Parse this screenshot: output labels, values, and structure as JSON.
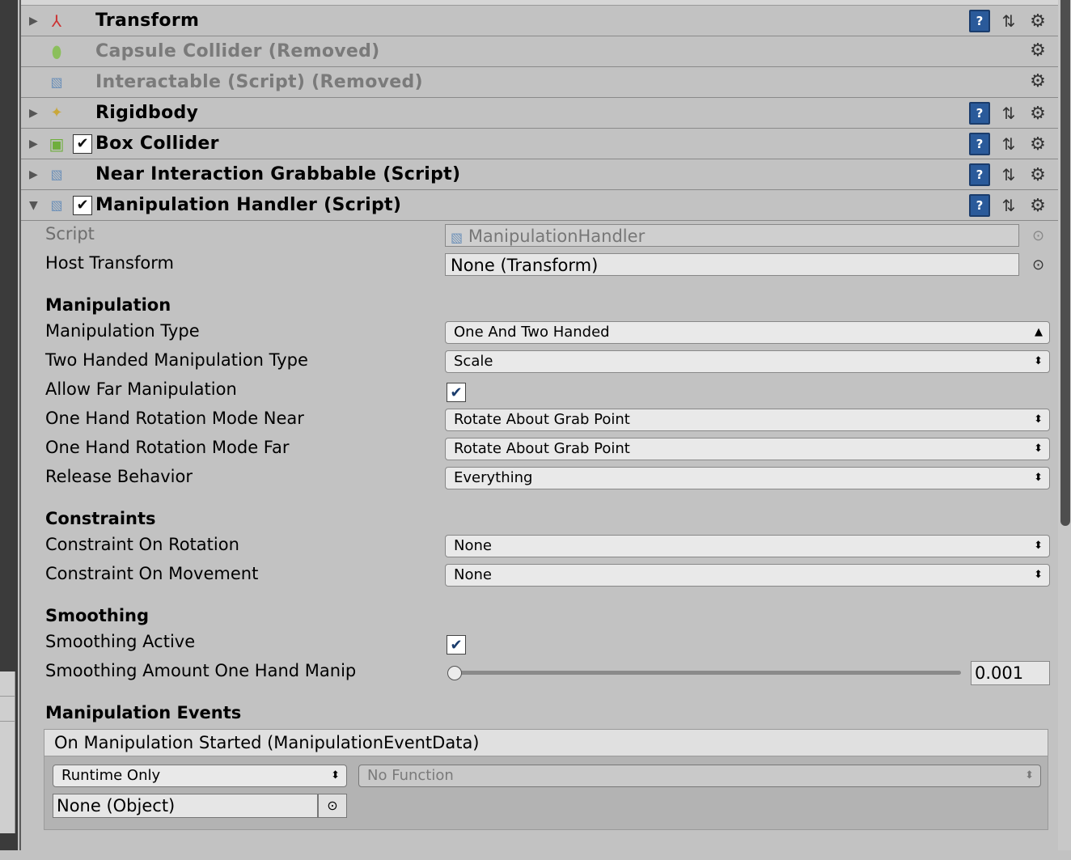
{
  "components": [
    {
      "title": "Transform",
      "removed": false,
      "icon": "transform-icon",
      "has_check": false,
      "foldable": true,
      "icons": [
        "book",
        "sliders",
        "gear"
      ]
    },
    {
      "title": "Capsule Collider (Removed)",
      "removed": true,
      "icon": "capsule-collider-icon",
      "has_check": false,
      "foldable": false,
      "icons": [
        "gear"
      ]
    },
    {
      "title": "Interactable (Script) (Removed)",
      "removed": true,
      "icon": "script-icon",
      "has_check": false,
      "foldable": false,
      "icons": [
        "gear"
      ]
    },
    {
      "title": "Rigidbody",
      "removed": false,
      "icon": "rigidbody-icon",
      "has_check": false,
      "foldable": true,
      "icons": [
        "book",
        "sliders",
        "gear"
      ]
    },
    {
      "title": "Box Collider",
      "removed": false,
      "icon": "box-collider-icon",
      "has_check": true,
      "foldable": true,
      "icons": [
        "book",
        "sliders",
        "gear"
      ]
    },
    {
      "title": "Near Interaction Grabbable (Script)",
      "removed": false,
      "icon": "script-icon",
      "has_check": false,
      "foldable": true,
      "icons": [
        "book",
        "sliders",
        "gear"
      ]
    },
    {
      "title": "Manipulation Handler (Script)",
      "removed": false,
      "icon": "script-icon",
      "has_check": true,
      "foldable": true,
      "expanded": true,
      "icons": [
        "book",
        "sliders",
        "gear"
      ]
    }
  ],
  "handler": {
    "script_label": "Script",
    "script_value": "ManipulationHandler",
    "host_label": "Host Transform",
    "host_value": "None (Transform)",
    "manipulation_header": "Manipulation",
    "manipulation_type_label": "Manipulation Type",
    "manipulation_type_value": "One And Two Handed",
    "two_handed_label": "Two Handed Manipulation Type",
    "two_handed_value": "Scale",
    "allow_far_label": "Allow Far Manipulation",
    "allow_far_checked": true,
    "rot_near_label": "One Hand Rotation Mode Near",
    "rot_near_value": "Rotate About Grab Point",
    "rot_far_label": "One Hand Rotation Mode Far",
    "rot_far_value": "Rotate About Grab Point",
    "release_label": "Release Behavior",
    "release_value": "Everything",
    "constraints_header": "Constraints",
    "constraint_rot_label": "Constraint On Rotation",
    "constraint_rot_value": "None",
    "constraint_mov_label": "Constraint On Movement",
    "constraint_mov_value": "None",
    "smoothing_header": "Smoothing",
    "smoothing_active_label": "Smoothing Active",
    "smoothing_active_checked": true,
    "smoothing_amount_label": "Smoothing Amount One Hand Manip",
    "smoothing_amount_value": "0.001",
    "smoothing_amount_fraction": 0.001,
    "events_header": "Manipulation Events",
    "event_title": "On Manipulation Started (ManipulationEventData)",
    "event_runtime": "Runtime Only",
    "event_function": "No Function",
    "event_object": "None (Object)"
  },
  "colors": {
    "accent": "#2a5a9a",
    "panel": "#c2c2c2"
  }
}
